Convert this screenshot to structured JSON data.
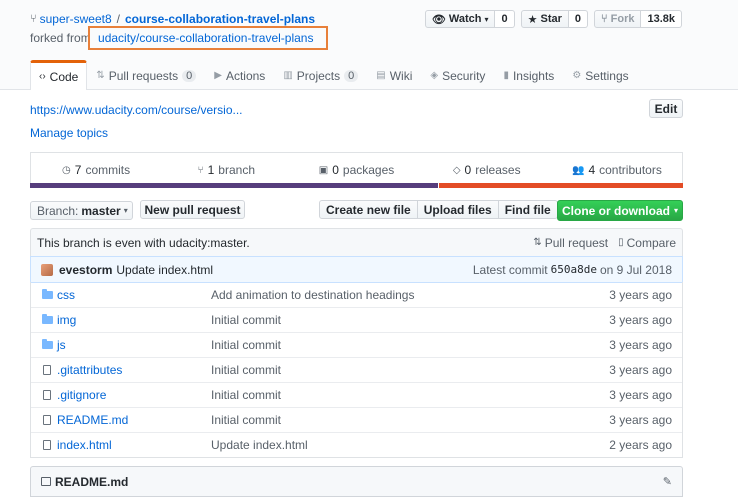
{
  "repo": {
    "owner": "super-sweet8",
    "separator": "/",
    "name": "course-collaboration-travel-plans",
    "forked_from_prefix": "forked from",
    "forked_from_link": "udacity/course-collaboration-travel-plans",
    "watch_label": "Watch",
    "watch_count": "0",
    "star_label": "Star",
    "star_count": "0",
    "fork_label": "Fork",
    "fork_count": "13.8k"
  },
  "tabs": [
    {
      "label": "Code",
      "icon": "code-icon"
    },
    {
      "label": "Pull requests",
      "count": "0",
      "icon": "pull-request-icon"
    },
    {
      "label": "Actions",
      "icon": "actions-icon"
    },
    {
      "label": "Projects",
      "count": "0",
      "icon": "project-icon"
    },
    {
      "label": "Wiki",
      "icon": "wiki-icon"
    },
    {
      "label": "Security",
      "icon": "shield-icon"
    },
    {
      "label": "Insights",
      "icon": "graph-icon"
    },
    {
      "label": "Settings",
      "icon": "gear-icon"
    }
  ],
  "about": {
    "url": "https://www.udacity.com/course/versio...",
    "manage_topics": "Manage topics",
    "edit_label": "Edit"
  },
  "summary": [
    {
      "count": "7",
      "label": "commits",
      "icon": "history-icon"
    },
    {
      "count": "1",
      "label": "branch",
      "icon": "branch-icon"
    },
    {
      "count": "0",
      "label": "packages",
      "icon": "package-icon"
    },
    {
      "count": "0",
      "label": "releases",
      "icon": "tag-icon"
    },
    {
      "count": "4",
      "label": "contributors",
      "icon": "people-icon"
    }
  ],
  "lang_colors": {
    "primary": "#563d7c",
    "secondary": "#e34c26"
  },
  "file_nav": {
    "branch_prefix": "Branch:",
    "branch_name": "master",
    "new_pr": "New pull request",
    "create_file": "Create new file",
    "upload_files": "Upload files",
    "find_file": "Find file",
    "clone": "Clone or download"
  },
  "branch_info": {
    "text": "This branch is even with udacity:master.",
    "pull_request": "Pull request",
    "compare": "Compare"
  },
  "latest_commit": {
    "author": "evestorm",
    "message": "Update index.html",
    "prefix": "Latest commit",
    "sha": "650a8de",
    "date": "on 9 Jul 2018"
  },
  "files": [
    {
      "name": "css",
      "type": "dir",
      "message": "Add animation to destination headings",
      "age": "3 years ago"
    },
    {
      "name": "img",
      "type": "dir",
      "message": "Initial commit",
      "age": "3 years ago"
    },
    {
      "name": "js",
      "type": "dir",
      "message": "Initial commit",
      "age": "3 years ago"
    },
    {
      "name": ".gitattributes",
      "type": "file",
      "message": "Initial commit",
      "age": "3 years ago"
    },
    {
      "name": ".gitignore",
      "type": "file",
      "message": "Initial commit",
      "age": "3 years ago"
    },
    {
      "name": "README.md",
      "type": "file",
      "message": "Initial commit",
      "age": "3 years ago"
    },
    {
      "name": "index.html",
      "type": "file",
      "message": "Update index.html",
      "age": "2 years ago"
    }
  ],
  "readme": {
    "title": "README.md"
  }
}
